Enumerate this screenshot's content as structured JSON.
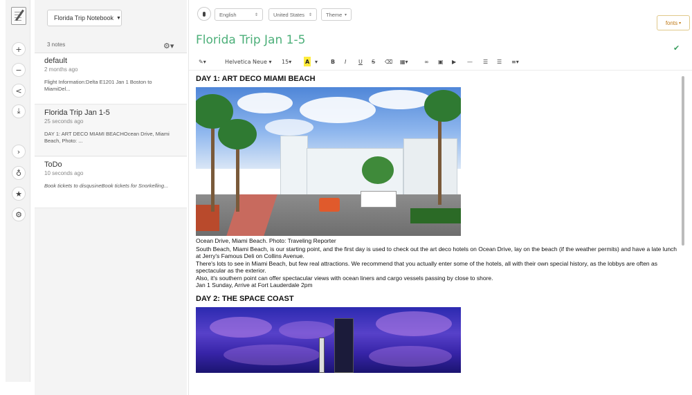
{
  "notebook": {
    "label": "Florida Trip Notebook"
  },
  "notes_list": {
    "count_label": "3 notes",
    "items": [
      {
        "title": "default",
        "time": "2 months ago",
        "snippet": "Flight Information:Delta E1201 Jan 1 Boston to MiamiDel..."
      },
      {
        "title": "Florida Trip Jan 1-5",
        "time": "25 seconds ago",
        "snippet": "DAY 1: ART DECO MIAMI BEACHOcean Drive, Miami Beach, Photo: ..."
      },
      {
        "title": "ToDo",
        "time": "10 seconds ago",
        "snippet": "Book tickets to disqusineBook tickets for Snorkelling..."
      }
    ]
  },
  "topbar": {
    "language": "English",
    "country": "United States",
    "theme": "Theme",
    "badge": "fonts"
  },
  "editor": {
    "title": "Florida Trip Jan 1-5",
    "toolbar": {
      "font_family": "Helvetica Neue",
      "font_size": "15",
      "highlight": "A"
    },
    "content": {
      "day1_heading": "DAY 1: ART DECO MIAMI BEACH",
      "caption1": "Ocean Drive, Miami Beach. Photo: Traveling Reporter",
      "para1": "South Beach, Miami Beach, is our starting point, and the first day is used to check out the art deco hotels on Ocean Drive, lay on the beach (if the weather permits) and have a late lunch at Jerry's Famous Deli on Collins Avenue.",
      "para2": "There's lots to see in Miami Beach, but few real attractions. We recommend that you actually enter some of the hotels, all with their own special history, as the lobbys are often as spectacular as the exterior.",
      "para3": "Also, it's southern point can offer spectacular views with ocean liners and cargo vessels passing by close to shore.",
      "para4": "Jan 1 Sunday, Arrive at Fort Lauderdale 2pm",
      "day2_heading": "DAY 2: THE SPACE COAST"
    }
  },
  "icons": [
    "compose-icon",
    "add-icon",
    "minus-icon",
    "share-icon",
    "download-icon",
    "terminal-icon",
    "bulb-icon",
    "star-icon",
    "settings-icon"
  ],
  "colors": {
    "title_green": "#4caf79",
    "badge_orange": "#c07a17",
    "highlight_yellow": "#ffec3d"
  }
}
